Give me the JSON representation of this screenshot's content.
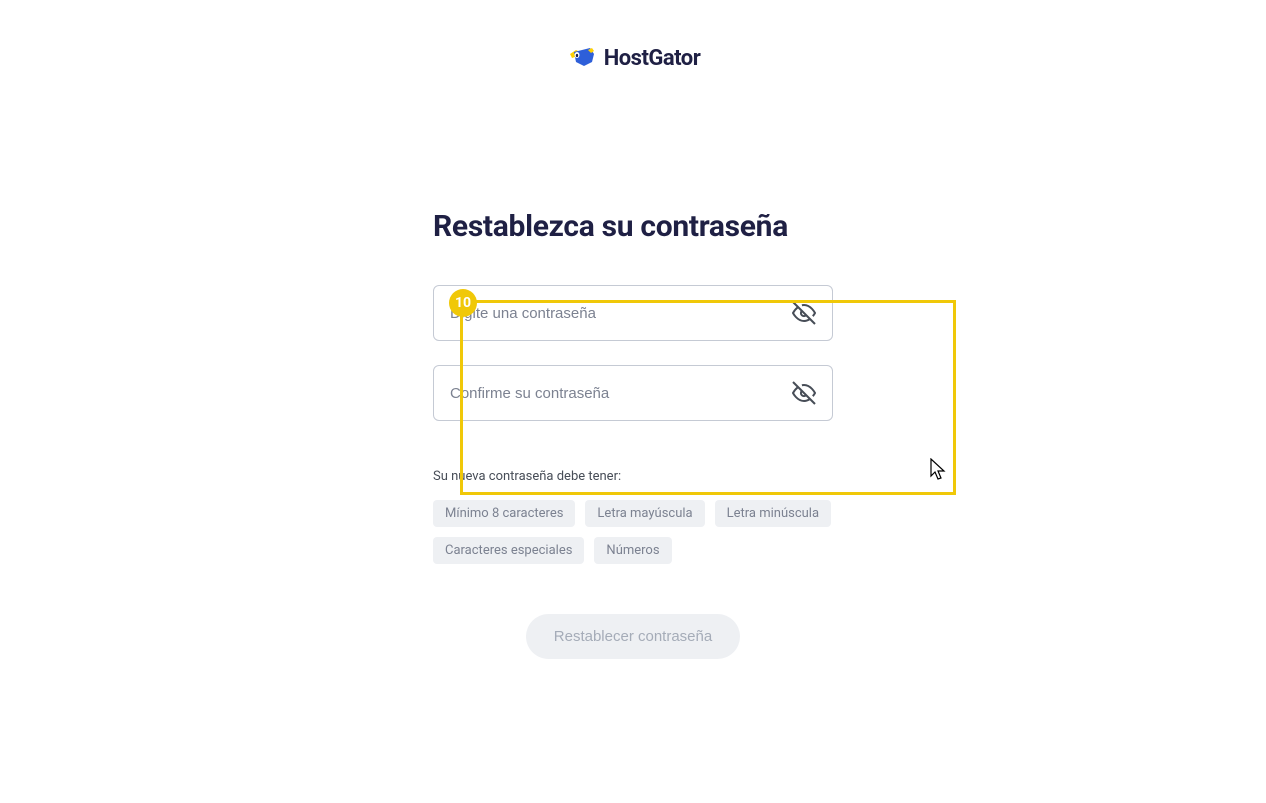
{
  "logo": {
    "text": "HostGator"
  },
  "page": {
    "title": "Restablezca su contraseña"
  },
  "highlight": {
    "badge": "10"
  },
  "inputs": {
    "password_placeholder": "Digite una contraseña",
    "confirm_placeholder": "Confirme su contraseña"
  },
  "requirements": {
    "label": "Su nueva contraseña debe tener:",
    "chips": [
      "Mínimo 8 caracteres",
      "Letra mayúscula",
      "Letra minúscula",
      "Caracteres especiales",
      "Números"
    ]
  },
  "submit": {
    "label": "Restablecer contraseña"
  }
}
